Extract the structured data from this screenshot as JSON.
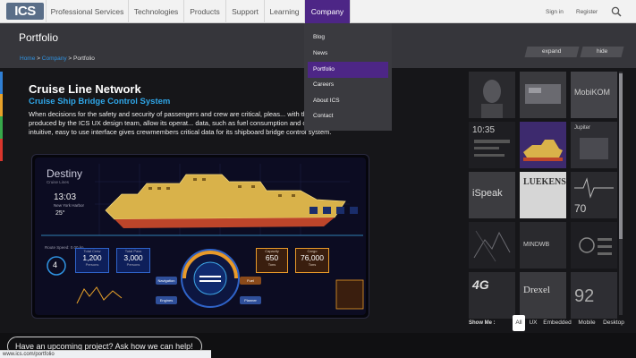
{
  "brand": {
    "logo": "ICS"
  },
  "nav": {
    "items": [
      "Professional Services",
      "Technologies",
      "Products",
      "Support",
      "Learning",
      "Company"
    ],
    "sign_in": "Sign in",
    "register": "Register"
  },
  "header": {
    "title": "Portfolio"
  },
  "breadcrumb": {
    "home": "Home",
    "sep1": ">",
    "company": "Company",
    "sep2": ">",
    "current": "Portfolio"
  },
  "dropdown": {
    "items": [
      "Blog",
      "News",
      "Portfolio",
      "Careers",
      "About ICS",
      "Contact"
    ],
    "active": "Portfolio"
  },
  "panel_tabs": {
    "expand": "expand",
    "hide": "hide"
  },
  "project": {
    "title": "Cruise Line Network",
    "subtitle": "Cruise Ship Bridge Control System",
    "description": "When decisions for the safety and security of passengers and crew are critical, pleas... with the Cruise Line Network, produced by the ICS UX design team, allow its operat... data, such as fuel consumption and cargo capacity. This intuitive, easy to use interface gives crewmembers critical data for its shipboard bridge control system."
  },
  "screenshot": {
    "ship_name": "Destiny",
    "ship_sub": "Cruise Lines",
    "time": "13:03",
    "location": "New York Harbor",
    "temp": "25°",
    "speed_label": "Route Speed: 0.00 kn",
    "speed": "4",
    "cards": [
      {
        "label": "Total Crew",
        "value": "1,200",
        "unit": "Persons"
      },
      {
        "label": "Total Pass",
        "value": "3,000",
        "unit": "Persons"
      },
      {
        "label": "Capacity",
        "value": "650",
        "unit": "Tons"
      },
      {
        "label": "Cargo",
        "value": "76,000",
        "unit": "Tons"
      }
    ],
    "buttons": [
      "Navigation",
      "Fuel",
      "Engines",
      "Planner"
    ]
  },
  "tiles": [
    {
      "text": ""
    },
    {
      "text": ""
    },
    {
      "text": "MobiKOM"
    },
    {
      "text": "10:35"
    },
    {
      "text": ""
    },
    {
      "text": "Jupiter"
    },
    {
      "text": "iSpeak"
    },
    {
      "text": "LUEKENS"
    },
    {
      "text": "70"
    },
    {
      "text": ""
    },
    {
      "text": "MINDWB"
    },
    {
      "text": ""
    },
    {
      "text": "4G"
    },
    {
      "text": "Drexel"
    },
    {
      "text": "92"
    }
  ],
  "filters": {
    "label": "Show Me :",
    "items": [
      "All",
      "UX",
      "Embedded",
      "Mobile",
      "Desktop"
    ],
    "active": "All"
  },
  "footer": {
    "cta": "Have an upcoming project? Ask how we can help!",
    "status_url": "www.ics.com/portfolio"
  },
  "colors": {
    "accent": "#4d2686",
    "link": "#2f93e2",
    "subtitle": "#2fa6e8",
    "side_accents": [
      "#2f7fd4",
      "#e8a22a",
      "#37a84a",
      "#d9352c"
    ]
  }
}
